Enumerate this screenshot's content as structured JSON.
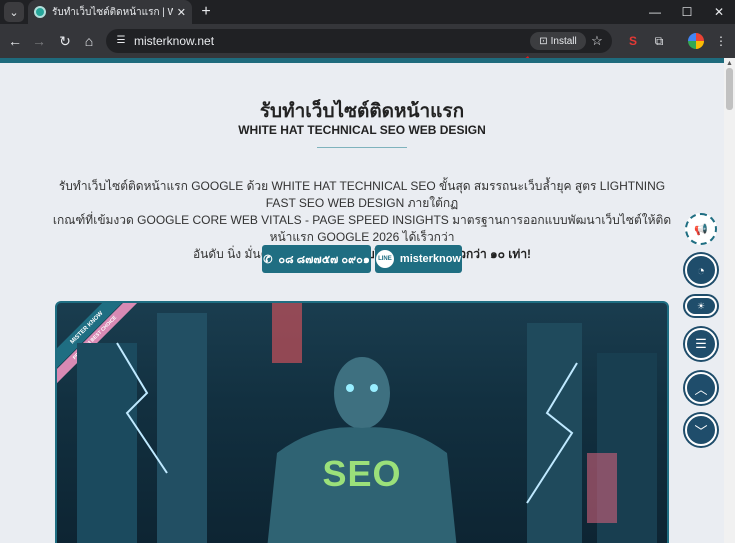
{
  "tab": {
    "title": "รับทำเว็บไซต์ติดหน้าแรก | WHITE HAT",
    "close": "✕",
    "menu": "⌄",
    "new_tab": "+"
  },
  "window": {
    "minimize": "—",
    "maximize": "☐",
    "close": "✕"
  },
  "toolbar": {
    "url": "misterknow.net",
    "install_label": "Install",
    "star": "☆"
  },
  "page": {
    "title": "รับทำเว็บไซต์ติดหน้าแรก",
    "subtitle": "WHITE HAT TECHNICAL SEO WEB DESIGN",
    "desc_line1": "รับทำเว็บไซต์ติดหน้าแรก GOOGLE ด้วย WHITE HAT TECHNICAL SEO ขั้นสุด สมรรถนะเว็บล้ำยุค สูตร LIGHTNING FAST SEO WEB DESIGN ภายใต้กฏ",
    "desc_line2": "เกณฑ์ที่เข้มงวด GOOGLE CORE WEB VITALS - PAGE SPEED INSIGHTS มาตรฐานการออกแบบพัฒนาเว็บไซต์ให้ติดหน้าแรก GOOGLE 2026 ได้เร็วกว่า",
    "desc_line3_prefix": "อันดับ นิ่ง มั่นคง ยั่งยืน กว่า ",
    "desc_line3_bold": "หน้าเว็บโหลดข้อมูลได้เร็วกว่า ๑๐ เท่า!",
    "phone_label": "๐๘ ๘๗๗๕๗ ๐๙๐๑",
    "line_badge": "LINE",
    "line_label": "misterknow",
    "ribbon1": "MISTER KNOW",
    "ribbon2": "PREMIUM BEST CHOICE",
    "seo_text": "SEO"
  },
  "colors": {
    "accent": "#1f6e82",
    "nav": "#1f4d6b"
  }
}
